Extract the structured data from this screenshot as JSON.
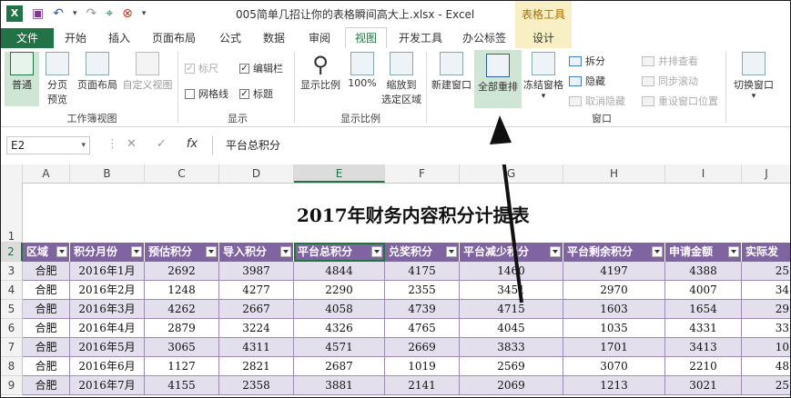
{
  "window": {
    "title": "005简单几招让你的表格瞬间高大上.xlsx - Excel",
    "context_tools": "表格工具"
  },
  "tabs": {
    "file": "文件",
    "items": [
      "开始",
      "插入",
      "页面布局",
      "公式",
      "数据",
      "审阅",
      "视图",
      "开发工具",
      "办公标签",
      "设计"
    ],
    "active": "视图"
  },
  "ribbon": {
    "workbook_views": {
      "title": "工作簿视图",
      "normal": "普通",
      "page_break_1": "分页",
      "page_break_2": "预览",
      "page_layout": "页面布局",
      "custom_views": "自定义视图"
    },
    "show": {
      "title": "显示",
      "ruler": "标尺",
      "formula_bar": "编辑栏",
      "gridlines": "网格线",
      "headings": "标题"
    },
    "zoom": {
      "title": "显示比例",
      "zoom": "显示比例",
      "hundred": "100%",
      "zoom_sel_1": "缩放到",
      "zoom_sel_2": "选定区域"
    },
    "window": {
      "title": "窗口",
      "new_window": "新建窗口",
      "arrange_all": "全部重排",
      "freeze": "冻结窗格",
      "split": "拆分",
      "hide": "隐藏",
      "unhide": "取消隐藏",
      "side_by_side": "并排查看",
      "sync_scroll": "同步滚动",
      "reset_pos": "重设窗口位置",
      "switch": "切换窗口"
    }
  },
  "formula_bar": {
    "name_box": "E2",
    "cancel": "✕",
    "enter": "✓",
    "fx": "fx",
    "value": "平台总积分"
  },
  "sheet": {
    "columns": [
      "A",
      "B",
      "C",
      "D",
      "E",
      "F",
      "G",
      "H",
      "I",
      "J"
    ],
    "rows": [
      "1",
      "2",
      "3",
      "4",
      "5",
      "6",
      "7",
      "8",
      "9"
    ],
    "title": "2017年财务内容积分计提表",
    "headers": [
      "区域",
      "积分月份",
      "预估积分",
      "导入积分",
      "平台总积分",
      "兑奖积分",
      "平台减少积分",
      "平台剩余积分",
      "申请金额",
      "实际发"
    ],
    "data": [
      [
        "合肥",
        "2016年1月",
        "2692",
        "3987",
        "4844",
        "4175",
        "1460",
        "4197",
        "4388",
        "25"
      ],
      [
        "合肥",
        "2016年2月",
        "1248",
        "4277",
        "2290",
        "2355",
        "3451",
        "2970",
        "4007",
        "34"
      ],
      [
        "合肥",
        "2016年3月",
        "4262",
        "2667",
        "4058",
        "4739",
        "4715",
        "1603",
        "1654",
        "29"
      ],
      [
        "合肥",
        "2016年4月",
        "2879",
        "3224",
        "4326",
        "4765",
        "4045",
        "1035",
        "4331",
        "33"
      ],
      [
        "合肥",
        "2016年5月",
        "3065",
        "4311",
        "4571",
        "2669",
        "3833",
        "1701",
        "3413",
        "10"
      ],
      [
        "合肥",
        "2016年6月",
        "1127",
        "2821",
        "2687",
        "1019",
        "2569",
        "3070",
        "2210",
        "48"
      ],
      [
        "合肥",
        "2016年7月",
        "4155",
        "2358",
        "3881",
        "2141",
        "2069",
        "1213",
        "3021",
        "25"
      ]
    ]
  },
  "colors": {
    "excel_green": "#217346",
    "header_purple": "#8064a2",
    "band_lavender": "#e4dfec"
  }
}
